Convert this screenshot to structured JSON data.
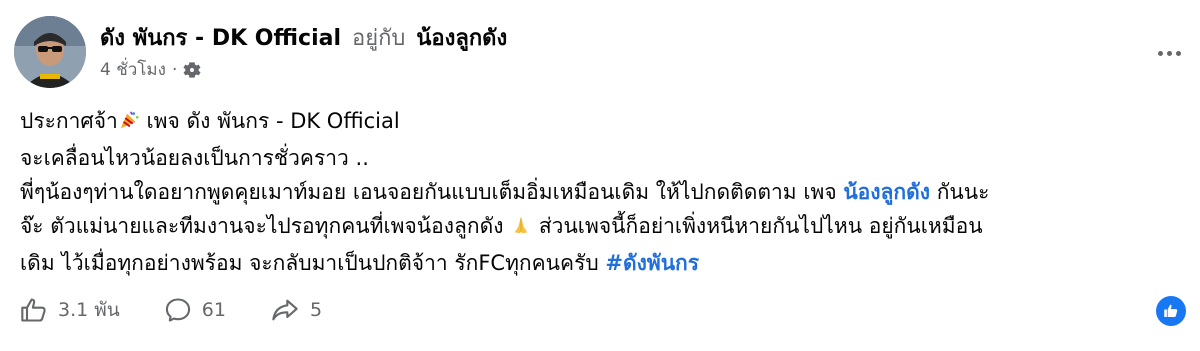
{
  "header": {
    "author": "ดัง พันกร - DK Official",
    "with_text": "อยู่กับ",
    "tagged_page": "น้องลูกดัง",
    "time": "4 ชั่วโมง",
    "dot": "·",
    "privacy_icon": "gear-icon",
    "more_icon": "more-options-icon"
  },
  "post": {
    "line1_a": "ประกาศจ้า",
    "line1_emoji": "party-popper-icon",
    "line1_b": " เพจ ดัง พันกร - DK Official",
    "line2": "จะเคลื่อนไหวน้อยลงเป็นการชั่วคราว ..",
    "line3_a": "พี่ๆน้องๆท่านใดอยากพูดคุยเมาท์มอย เอนจอยกันแบบเต็มอิ่มเหมือนเดิม ให้ไปกดติดตาม เพจ ",
    "line3_mention": "น้องลูกดัง",
    "line3_b": " กันนะ",
    "line4_a": "จ๊ะ ตัวแม่นายและทีมงานจะไปรอทุกคนที่เพจน้องลูกดัง ",
    "line4_emoji": "folded-hands-icon",
    "line4_b": " ส่วนเพจนี้ก็อย่าเพิ่งหนีหายกันไปไหน อยู่กันเหมือน",
    "line5_a": "เดิม ไว้เมื่อทุกอย่างพร้อม จะกลับมาเป็นปกติจ้าา รักFCทุกคนครับ ",
    "line5_hashtag": "#ดังพันกร"
  },
  "actions": {
    "like_count": "3.1 พัน",
    "comment_count": "61",
    "share_count": "5"
  },
  "colors": {
    "link": "#216fdb",
    "secondary_text": "#65676b",
    "badge": "#1877f2"
  }
}
